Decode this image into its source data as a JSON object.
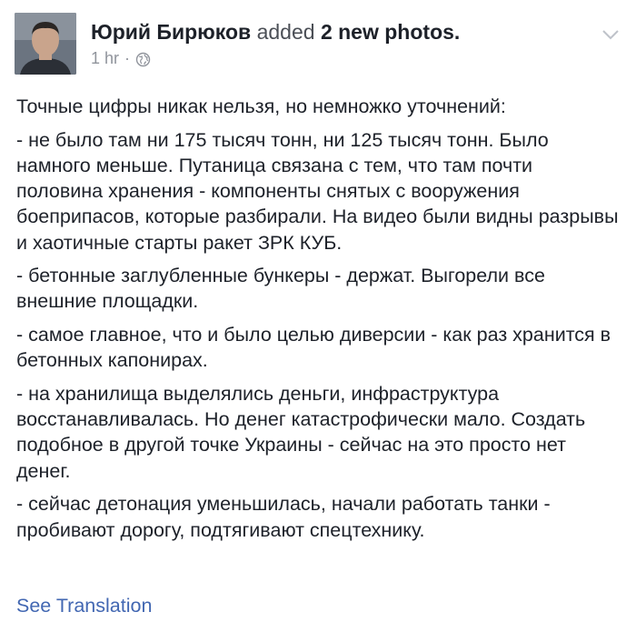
{
  "post": {
    "author": "Юрий Бирюков",
    "action": "added",
    "photos_count": "2 new photos.",
    "timestamp": "1 hr",
    "separator": "·",
    "paragraphs": [
      "Точные цифры никак нельзя, но немножко уточнений:",
      "- не было там ни 175 тысяч тонн, ни 125 тысяч тонн. Было намного меньше. Путаница связана с тем, что там почти половина хранения - компоненты снятых с вооружения боеприпасов, которые разбирали. На видео были видны разрывы и хаотичные старты ракет ЗРК КУБ.",
      "- бетонные заглубленные бункеры - держат. Выгорели все внешние площадки.",
      "- самое главное, что и было целью диверсии - как раз хранится в бетонных капонирах.",
      "- на хранилища выделялись деньги, инфраструктура восстанавливалась. Но денег катастрофически мало. Создать подобное в другой точке Украины - сейчас на это просто нет денег.",
      "- сейчас детонация уменьшилась, начали работать танки - пробивают дорогу, подтягивают спецтехнику."
    ],
    "see_translation": "See Translation"
  },
  "icons": {
    "privacy": "globe-icon",
    "menu": "chevron-down-icon"
  },
  "colors": {
    "link": "#4267b2",
    "text": "#1d2129",
    "meta": "#90949c"
  }
}
